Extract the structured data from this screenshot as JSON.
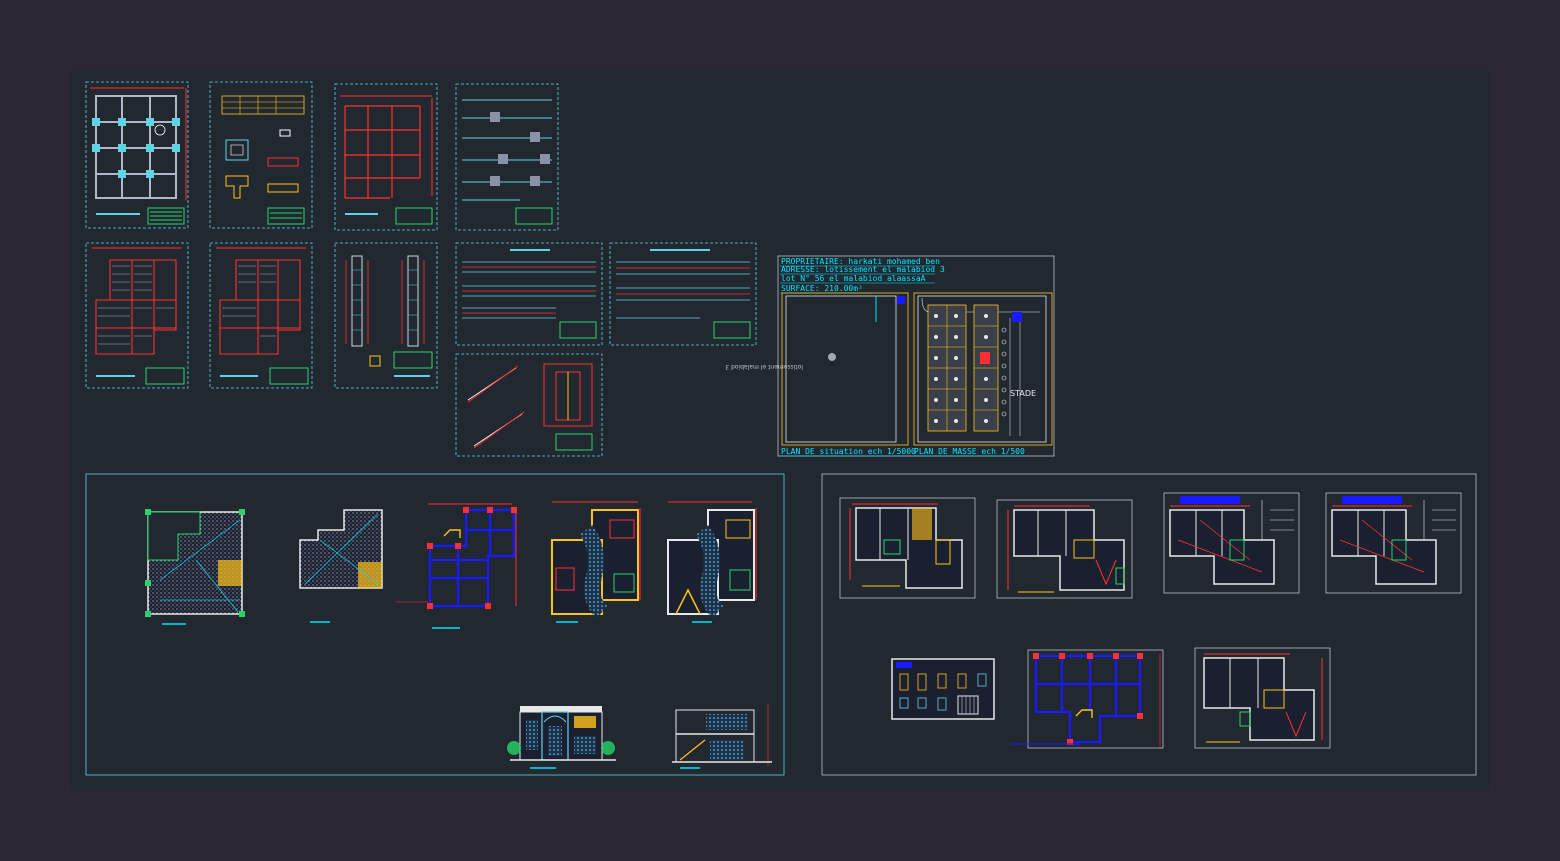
{
  "window": {
    "title": ""
  },
  "colors": {
    "outer_bg": "#2c2831",
    "model_bg": "#212830",
    "frame": "#5fd3e6",
    "structure_red": "#e02020",
    "wall_blue": "#1a1aff",
    "wall_yellow": "#ffc21a",
    "cyan": "#00e5ff",
    "green": "#27d36a",
    "white": "#e8e8e8"
  },
  "site_plan": {
    "lines": [
      "PROPRIETAIRE: harkati mohamed ben",
      "ADRESSE: lotissement el malabiod 3",
      "lot N° 56 el malabiod alaassaA",
      "SURFACE: 210.00m²"
    ],
    "situation_caption": "PLAN DE situation ech 1/5000",
    "masse_caption": "PLAN DE MASSE ech 1/500",
    "stadium_label": "STADE",
    "mirrored_note": "lotissement el malabiod 3"
  },
  "sheet_groups": {
    "structural_sheets": 12,
    "architectural_views": 7,
    "plan_variants": 7
  }
}
